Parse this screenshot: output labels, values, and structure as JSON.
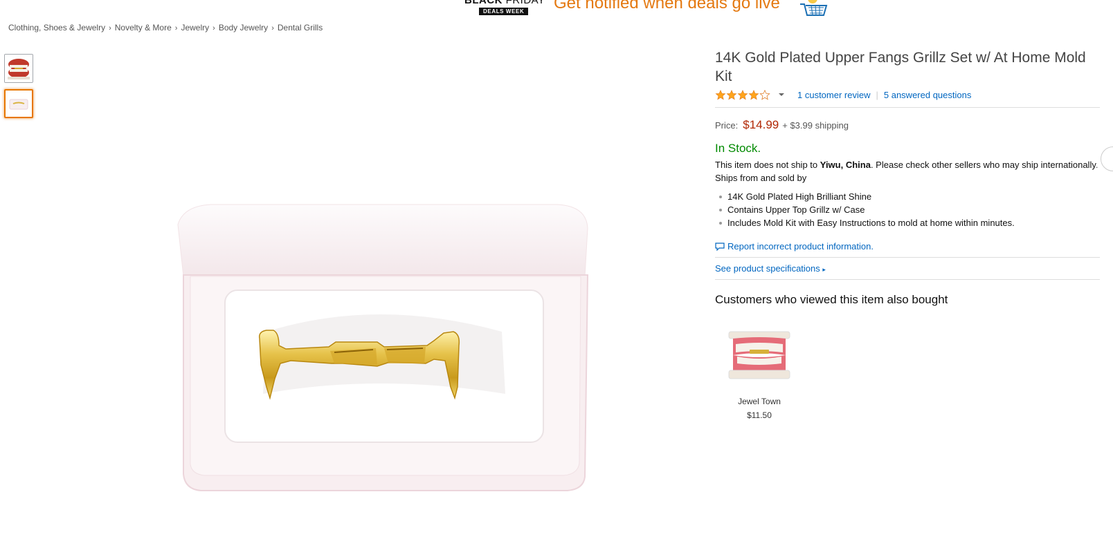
{
  "banner": {
    "logo_black": "BLACK",
    "logo_friday": "FRIDAY",
    "logo_sub": "DEALS WEEK",
    "message": "Get notified when deals go live",
    "cart_icon": "cart-icon"
  },
  "breadcrumb": [
    "Clothing, Shoes & Jewelry",
    "Novelty & More",
    "Jewelry",
    "Body Jewelry",
    "Dental Grills"
  ],
  "product": {
    "title": "14K Gold Plated Upper Fangs Grillz Set w/ At Home Mold Kit",
    "rating": 4,
    "rating_max": 5,
    "reviews_link": "1 customer review",
    "questions_link": "5 answered questions",
    "price_label": "Price:",
    "price": "$14.99",
    "shipping": "+ $3.99 shipping",
    "stock": "In Stock.",
    "ship_note_1": "This item does not ship to ",
    "ship_location": "Yiwu, China",
    "ship_note_2": ". Please check other sellers who may ship internationally",
    "ship_note_3": ".",
    "ships_from": "Ships from and sold by",
    "bullets": [
      "14K Gold Plated High Brilliant Shine",
      "Contains Upper Top Grillz w/ Case",
      "Includes Mold Kit with Easy Instructions to mold at home within minutes."
    ],
    "report_link": "Report incorrect product information.",
    "specs_link": "See product specifications"
  },
  "also_bought": {
    "heading": "Customers who viewed this item also bought",
    "items": [
      {
        "name": "Jewel Town",
        "price": "$11.50"
      }
    ]
  },
  "colors": {
    "link": "#0066c0",
    "price": "#b12704",
    "stock": "#008a00",
    "banner_text": "#e47911",
    "star": "#ffa41c"
  }
}
